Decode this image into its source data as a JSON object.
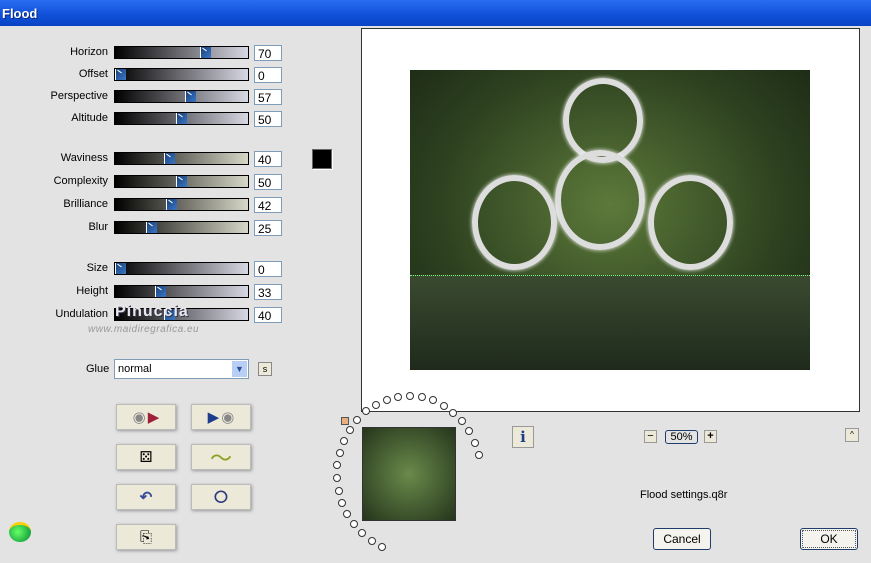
{
  "window": {
    "title": "Flood"
  },
  "sliders": [
    {
      "label": "Horizon",
      "value": "70",
      "fraction": 0.7,
      "tone": "cool"
    },
    {
      "label": "Offset",
      "value": "0",
      "fraction": 0,
      "tone": "cool"
    },
    {
      "label": "Perspective",
      "value": "57",
      "fraction": 0.57,
      "tone": "cool"
    },
    {
      "label": "Altitude",
      "value": "50",
      "fraction": 0.5,
      "tone": "cool"
    },
    {
      "label": "Waviness",
      "value": "40",
      "fraction": 0.4,
      "tone": "warm"
    },
    {
      "label": "Complexity",
      "value": "50",
      "fraction": 0.5,
      "tone": "warm"
    },
    {
      "label": "Brilliance",
      "value": "42",
      "fraction": 0.42,
      "tone": "warm"
    },
    {
      "label": "Blur",
      "value": "25",
      "fraction": 0.25,
      "tone": "warm"
    },
    {
      "label": "Size",
      "value": "0",
      "fraction": 0,
      "tone": "cool"
    },
    {
      "label": "Height",
      "value": "33",
      "fraction": 0.33,
      "tone": "cool"
    },
    {
      "label": "Undulation",
      "value": "40",
      "fraction": 0.4,
      "tone": "cool"
    }
  ],
  "color_swatch": "#000000",
  "watermark": {
    "name": "Pinuccia",
    "url": "www.maidiregrafica.eu"
  },
  "glue": {
    "label": "Glue",
    "value": "normal",
    "s_button": "s"
  },
  "zoom": {
    "minus": "−",
    "value": "50%",
    "plus": "+"
  },
  "info_label": "i",
  "up_label": "^",
  "settings_file": "Flood settings.q8r",
  "buttons": {
    "cancel": "Cancel",
    "ok": "OK"
  }
}
